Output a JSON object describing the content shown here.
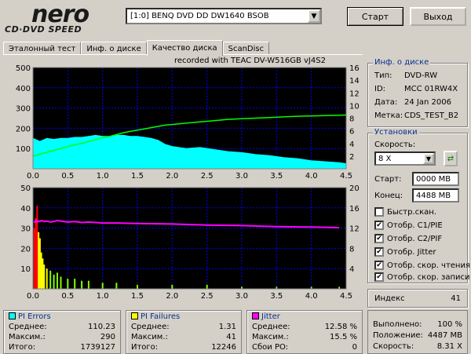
{
  "header": {
    "logo_top": "nero",
    "logo_bottom": "CD·DVD SPEED",
    "drive": "[1:0]  BENQ DVD DD DW1640 BSOB",
    "start_label": "Старт",
    "exit_label": "Выход"
  },
  "tabs": [
    {
      "label": "Эталонный тест",
      "active": false
    },
    {
      "label": "Инф. о диске",
      "active": false
    },
    {
      "label": "Качество диска",
      "active": true
    },
    {
      "label": "ScanDisc",
      "active": false
    }
  ],
  "recorded_with": "recorded with TEAC    DV-W516GB       vJ4S2",
  "disc_info": {
    "title": "Инф. о диске",
    "type_label": "Тип:",
    "type_value": "DVD-RW",
    "id_label": "ID:",
    "id_value": "MCC 01RW4X",
    "date_label": "Дата:",
    "date_value": "24 Jan 2006",
    "label_label": "Метка:",
    "label_value": "CDS_TEST_B2"
  },
  "settings": {
    "title": "Установки",
    "speed_label": "Скорость:",
    "speed_value": "8 X",
    "start_label": "Старт:",
    "start_value": "0000 MB",
    "end_label": "Конец:",
    "end_value": "4488 MB",
    "checkboxes": [
      {
        "label": "Быстр.скан.",
        "checked": false
      },
      {
        "label": "Отобр. C1/PIE",
        "checked": true
      },
      {
        "label": "Отобр. C2/PIF",
        "checked": true
      },
      {
        "label": "Отобр. Jitter",
        "checked": true
      },
      {
        "label": "Отобр. скор. чтения",
        "checked": true
      },
      {
        "label": "Отобр. скор. записи",
        "checked": true
      }
    ]
  },
  "index": {
    "label": "Индекс",
    "value": "41"
  },
  "stats": {
    "pi_errors": {
      "title": "PI Errors",
      "color": "#00ffff",
      "avg_label": "Среднее:",
      "avg": "110.23",
      "max_label": "Максим.:",
      "max": "290",
      "total_label": "Итого:",
      "total": "1739127"
    },
    "pi_failures": {
      "title": "PI Failures",
      "color": "#ffff00",
      "avg_label": "Среднее:",
      "avg": "1.31",
      "max_label": "Максим.:",
      "max": "41",
      "total_label": "Итого:",
      "total": "12246"
    },
    "jitter": {
      "title": "Jitter",
      "color": "#ff00ff",
      "avg_label": "Среднее:",
      "avg": "12.58 %",
      "max_label": "Максим.:",
      "max": "15.5 %",
      "po_label": "Сбои PO:",
      "po": "0"
    }
  },
  "progress": {
    "done_label": "Выполнено:",
    "done": "100 %",
    "pos_label": "Положение:",
    "pos": "4487 MB",
    "speed_label": "Скорость:",
    "speed": "8.31 X"
  },
  "colors": {
    "plot_bg": "#000000",
    "pie": "#00ffff",
    "pif": "#7fff00",
    "pif_peak": "#ff0000",
    "jitter": "#ff00ff",
    "read_speed": "#00ff00",
    "grid": "#0000ff",
    "accent_text": "#0a2f8c"
  },
  "chart_data": [
    {
      "type": "area",
      "x": [
        0,
        0.1,
        0.2,
        0.3,
        0.4,
        0.5,
        0.6,
        0.7,
        0.8,
        0.9,
        1.0,
        1.1,
        1.2,
        1.3,
        1.4,
        1.5,
        1.6,
        1.7,
        1.8,
        1.9,
        2.0,
        2.2,
        2.4,
        2.6,
        2.8,
        3.0,
        3.2,
        3.4,
        3.6,
        3.8,
        4.0,
        4.2,
        4.4,
        4.5
      ],
      "series": [
        {
          "name": "PI Errors",
          "values": [
            150,
            135,
            150,
            145,
            150,
            150,
            155,
            155,
            160,
            165,
            160,
            160,
            165,
            165,
            160,
            160,
            155,
            150,
            140,
            120,
            110,
            100,
            105,
            95,
            85,
            80,
            70,
            65,
            55,
            50,
            40,
            35,
            30,
            25
          ]
        },
        {
          "name": "Read speed",
          "axis": "right",
          "values": [
            2.0,
            2.3,
            2.6,
            2.9,
            3.2,
            3.5,
            3.8,
            4.0,
            4.3,
            4.6,
            4.9,
            5.1,
            5.4,
            5.7,
            5.9,
            6.1,
            6.3,
            6.5,
            6.7,
            6.9,
            7.0,
            7.2,
            7.4,
            7.6,
            7.8,
            7.9,
            8.0,
            8.1,
            8.2,
            8.3,
            8.35,
            8.4,
            8.45,
            8.5
          ]
        }
      ],
      "xlim": [
        0,
        4.5
      ],
      "ylim": [
        0,
        500
      ],
      "y2lim": [
        0,
        16
      ],
      "xticks": [
        "0.0",
        "0.5",
        "1.0",
        "1.5",
        "2.0",
        "2.5",
        "3.0",
        "3.5",
        "4.0",
        "4.5"
      ],
      "yticks": [
        "100",
        "200",
        "300",
        "400",
        "500"
      ],
      "y2ticks": [
        "2",
        "4",
        "6",
        "8",
        "10",
        "12",
        "14",
        "16"
      ],
      "grid": true
    },
    {
      "type": "bar",
      "x": [
        0.02,
        0.04,
        0.06,
        0.08,
        0.1,
        0.12,
        0.14,
        0.16,
        0.2,
        0.25,
        0.3,
        0.35,
        0.4,
        0.5,
        0.6,
        0.7,
        0.8,
        1.0,
        1.2,
        1.5,
        2.0,
        2.5,
        3.0,
        3.5,
        4.0,
        4.4
      ],
      "series": [
        {
          "name": "PI Failures",
          "values": [
            30,
            35,
            41,
            28,
            25,
            18,
            15,
            12,
            10,
            9,
            7,
            8,
            6,
            5,
            5,
            4,
            4,
            3,
            3,
            2,
            2,
            2,
            1,
            1,
            1,
            1
          ]
        },
        {
          "name": "Jitter",
          "axis": "right",
          "values": [
            13,
            13.5,
            13.2,
            13.4,
            13.3,
            13.5,
            13.4,
            13.3,
            13.4,
            13.2,
            13.3,
            13.5,
            13.4,
            13.2,
            13.3,
            13.1,
            13.2,
            13.0,
            13.0,
            12.9,
            12.8,
            12.6,
            12.5,
            12.3,
            12.2,
            12.1
          ]
        }
      ],
      "xlim": [
        0,
        4.5
      ],
      "ylim": [
        0,
        50
      ],
      "y2lim": [
        0,
        20
      ],
      "xticks": [
        "0.0",
        "0.5",
        "1.0",
        "1.5",
        "2.0",
        "2.5",
        "3.0",
        "3.5",
        "4.0",
        "4.5"
      ],
      "yticks": [
        "10",
        "20",
        "30",
        "40",
        "50"
      ],
      "y2ticks": [
        "4",
        "8",
        "12",
        "16",
        "20"
      ],
      "grid": true
    }
  ]
}
